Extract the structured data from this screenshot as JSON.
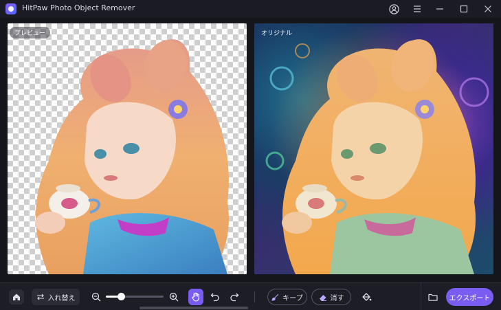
{
  "app": {
    "title": "HitPaw Photo Object Remover"
  },
  "window_controls": [
    "account-icon",
    "menu-icon",
    "minimize-icon",
    "maximize-icon",
    "close-icon"
  ],
  "panes": {
    "preview": {
      "label": "プレビュー"
    },
    "original": {
      "label": "オリジナル"
    }
  },
  "toolbar": {
    "swap_label": "入れ替え",
    "zoom_level": 0.26,
    "keep_label": "キープ",
    "erase_label": "消す",
    "export_label": "エクスポート"
  },
  "colors": {
    "accent": "#7a5df0",
    "background": "#15151c",
    "toolbar": "#1d1d26"
  }
}
